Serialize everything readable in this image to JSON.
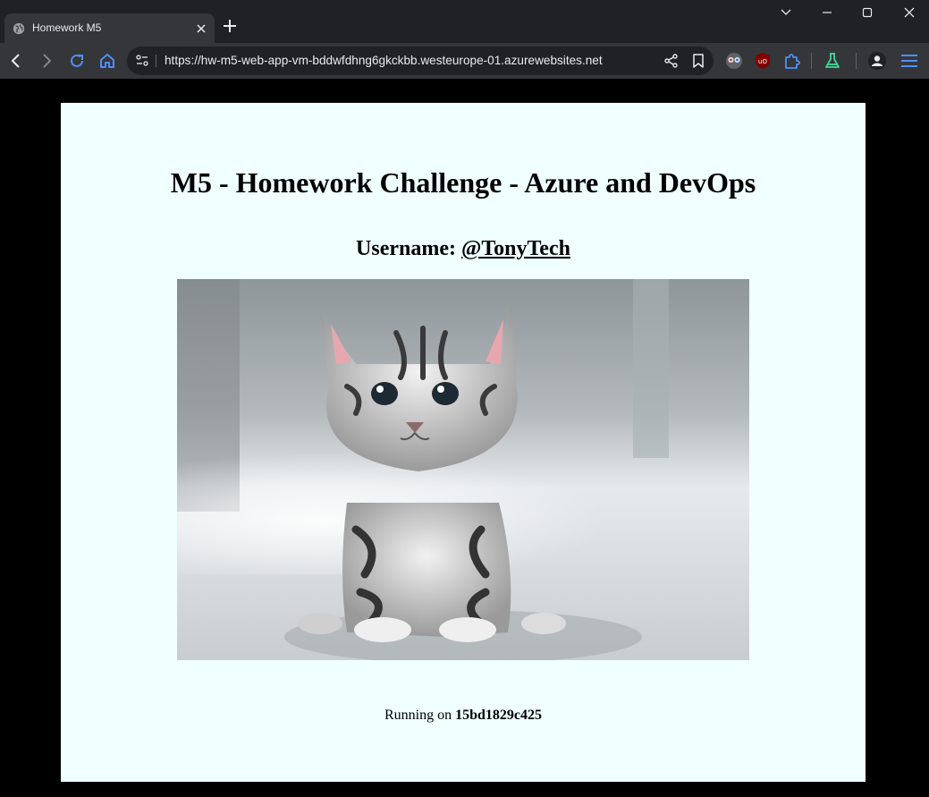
{
  "browser": {
    "tab_title": "Homework M5",
    "url": "https://hw-m5-web-app-vm-bddwfdhng6gkckbb.westeurope-01.azurewebsites.net",
    "icons": [
      "globe-icon",
      "close-icon",
      "plus-icon",
      "chevron-down-icon",
      "minimize-icon",
      "maximize-icon",
      "window-close-icon",
      "back-icon",
      "forward-icon",
      "reload-icon",
      "home-icon",
      "site-info-icon",
      "share-icon",
      "bookmark-icon",
      "extension-eyes-icon",
      "ublock-icon",
      "puzzle-icon",
      "flask-icon",
      "profile-icon",
      "menu-icon"
    ],
    "accent_color": "#4f8ff7"
  },
  "page": {
    "background": "#f0ffff",
    "heading": "M5 - Homework Challenge - Azure and DevOps",
    "username_label": "Username:",
    "username_link": "@TonyTech",
    "image_alt": "kitten",
    "running_on_label": "Running on",
    "host_id": "15bd1829c425"
  }
}
